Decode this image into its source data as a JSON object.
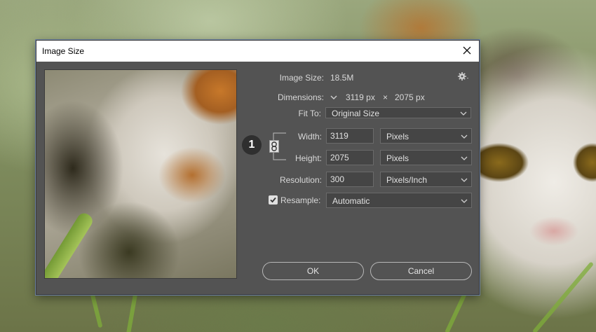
{
  "dialog": {
    "title": "Image Size",
    "close_icon": "close-icon",
    "gear_icon": "gear-icon"
  },
  "info": {
    "image_size_label": "Image Size:",
    "image_size_value": "18.5M",
    "dimensions_label": "Dimensions:",
    "dimensions_width": "3119 px",
    "dimensions_times": "×",
    "dimensions_height": "2075 px",
    "dimensions_icon": "chevron-down-icon"
  },
  "fit_to": {
    "label": "Fit To:",
    "value": "Original Size"
  },
  "width": {
    "label": "Width:",
    "value": "3119",
    "unit": "Pixels"
  },
  "height": {
    "label": "Height:",
    "value": "2075",
    "unit": "Pixels"
  },
  "resolution": {
    "label": "Resolution:",
    "value": "300",
    "unit": "Pixels/Inch"
  },
  "resample": {
    "label": "Resample:",
    "checked": true,
    "value": "Automatic"
  },
  "constrain": {
    "icon": "link-icon",
    "badge": "1"
  },
  "buttons": {
    "ok": "OK",
    "cancel": "Cancel"
  },
  "colors": {
    "dialog_bg": "#535353",
    "field_bg": "#454545",
    "text": "#d8d8d8"
  }
}
